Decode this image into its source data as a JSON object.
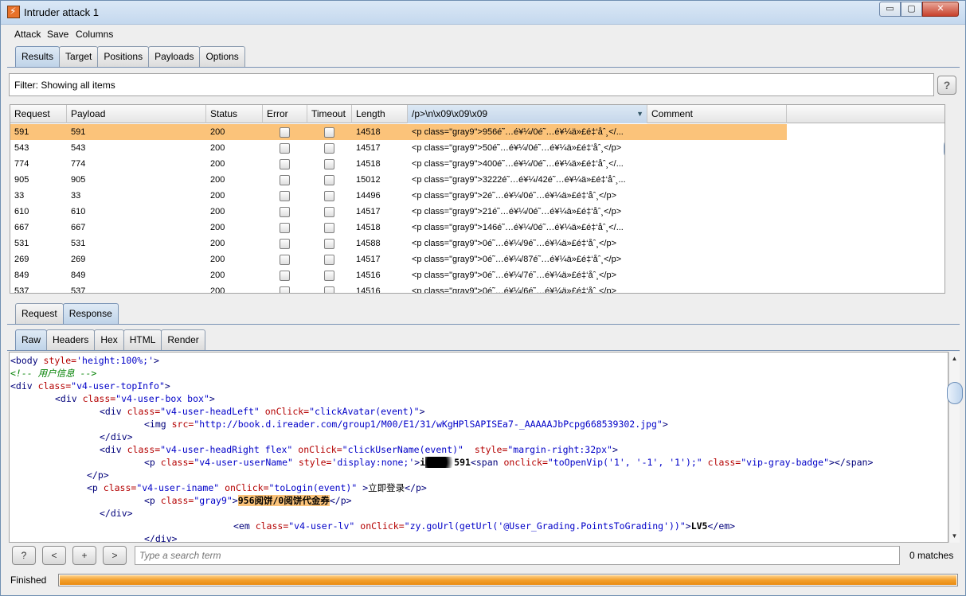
{
  "window": {
    "title": "Intruder attack 1"
  },
  "menu": [
    "Attack",
    "Save",
    "Columns"
  ],
  "main_tabs": [
    {
      "label": "Results",
      "active": true
    },
    {
      "label": "Target",
      "active": false
    },
    {
      "label": "Positions",
      "active": false
    },
    {
      "label": "Payloads",
      "active": false
    },
    {
      "label": "Options",
      "active": false
    }
  ],
  "filter": {
    "text": "Filter: Showing all items",
    "help": "?"
  },
  "results_table": {
    "columns": [
      "Request",
      "Payload",
      "Status",
      "Error",
      "Timeout",
      "Length",
      "/p>\\n\\x09\\x09\\x09",
      "Comment"
    ],
    "sorted_column": 6,
    "rows": [
      {
        "request": "591",
        "payload": "591",
        "status": "200",
        "length": "14518",
        "grep": "<p class=\"gray9\">956é˜…é¥¼/0é˜…é¥¼ä»£é‡‘åˆ¸</...",
        "selected": true
      },
      {
        "request": "543",
        "payload": "543",
        "status": "200",
        "length": "14517",
        "grep": "<p class=\"gray9\">50é˜…é¥¼/0é˜…é¥¼ä»£é‡‘åˆ¸</p>",
        "selected": false
      },
      {
        "request": "774",
        "payload": "774",
        "status": "200",
        "length": "14518",
        "grep": "<p class=\"gray9\">400é˜…é¥¼/0é˜…é¥¼ä»£é‡‘åˆ¸</...",
        "selected": false
      },
      {
        "request": "905",
        "payload": "905",
        "status": "200",
        "length": "15012",
        "grep": "<p class=\"gray9\">3222é˜…é¥¼/42é˜…é¥¼ä»£é‡‘åˆ¸...",
        "selected": false
      },
      {
        "request": "33",
        "payload": "33",
        "status": "200",
        "length": "14496",
        "grep": "<p class=\"gray9\">2é˜…é¥¼/0é˜…é¥¼ä»£é‡‘åˆ¸</p>",
        "selected": false
      },
      {
        "request": "610",
        "payload": "610",
        "status": "200",
        "length": "14517",
        "grep": "<p class=\"gray9\">21é˜…é¥¼/0é˜…é¥¼ä»£é‡‘åˆ¸</p>",
        "selected": false
      },
      {
        "request": "667",
        "payload": "667",
        "status": "200",
        "length": "14518",
        "grep": "<p class=\"gray9\">146é˜…é¥¼/0é˜…é¥¼ä»£é‡‘åˆ¸</...",
        "selected": false
      },
      {
        "request": "531",
        "payload": "531",
        "status": "200",
        "length": "14588",
        "grep": "<p class=\"gray9\">0é˜…é¥¼/9é˜…é¥¼ä»£é‡‘åˆ¸</p>",
        "selected": false
      },
      {
        "request": "269",
        "payload": "269",
        "status": "200",
        "length": "14517",
        "grep": "<p class=\"gray9\">0é˜…é¥¼/87é˜…é¥¼ä»£é‡‘åˆ¸</p>",
        "selected": false
      },
      {
        "request": "849",
        "payload": "849",
        "status": "200",
        "length": "14516",
        "grep": "<p class=\"gray9\">0é˜…é¥¼/7é˜…é¥¼ä»£é‡‘åˆ¸</p>",
        "selected": false
      },
      {
        "request": "537",
        "payload": "537",
        "status": "200",
        "length": "14516",
        "grep": "<p class=\"gray9\">0é˜…é¥¼/6é˜…é¥¼ä»£é‡‘åˆ¸</p>",
        "selected": false
      }
    ]
  },
  "req_resp_tabs": [
    {
      "label": "Request",
      "active": false
    },
    {
      "label": "Response",
      "active": true
    }
  ],
  "view_tabs": [
    {
      "label": "Raw",
      "active": true
    },
    {
      "label": "Headers",
      "active": false
    },
    {
      "label": "Hex",
      "active": false
    },
    {
      "label": "HTML",
      "active": false
    },
    {
      "label": "Render",
      "active": false
    }
  ],
  "response_code": {
    "l1_tag": "<body",
    "l1_attr": " style=",
    "l1_val": "'height:100%;'",
    "l1_end": ">",
    "l2": "<!-- 用户信息 -->",
    "l3_tag": "<div",
    "l3_attr": " class=",
    "l3_val": "\"v4-user-topInfo\"",
    "l3_end": ">",
    "l4_tag": "<div",
    "l4_attr": " class=",
    "l4_val": "\"v4-user-box box\"",
    "l4_end": ">",
    "l5_tag": "<div",
    "l5_attr1": " class=",
    "l5_val1": "\"v4-user-headLeft\"",
    "l5_attr2": " onClick=",
    "l5_val2": "\"clickAvatar(event)\"",
    "l5_end": ">",
    "l6_tag": "<img",
    "l6_attr": " src=",
    "l6_val": "\"http://book.d.ireader.com/group1/M00/E1/31/wKgHPlSAPISEa7-_AAAAAJbPcpg668539302.jpg\"",
    "l6_end": ">",
    "l7": "</div>",
    "l8_tag": "<div",
    "l8_attr1": " class=",
    "l8_val1": "\"v4-user-headRight flex\"",
    "l8_attr2": " onClick=",
    "l8_val2": "\"clickUserName(event)\"",
    "l8_attr3": "  style=",
    "l8_val3": "\"margin-right:32px\"",
    "l8_end": ">",
    "l9_tag": "<p",
    "l9_attr1": " class=",
    "l9_val1": "\"v4-user-userName\"",
    "l9_attr2": " style=",
    "l9_val2": "'display:none;'",
    "l9_end": ">",
    "l9_text_a": "i",
    "l9_text_b": "591",
    "l9_span": "<span",
    "l9_attr3": " onclick=",
    "l9_val3": "\"toOpenVip('1', '-1', '1');\"",
    "l9_attr4": " class=",
    "l9_val4": "\"vip-gray-badge\"",
    "l9_span_end": "></span>",
    "l10": "</p>",
    "l11_tag": "<p",
    "l11_attr1": " class=",
    "l11_val1": "\"v4-user-iname\"",
    "l11_attr2": " onClick=",
    "l11_val2": "\"toLogin(event)\"",
    "l11_end": " >",
    "l11_text": "立即登录",
    "l11_close": "</p>",
    "l12_tag": "<p",
    "l12_attr": " class=",
    "l12_val": "\"gray9\"",
    "l12_end": ">",
    "l12_text": "956阅饼/0阅饼代金券",
    "l12_close": "</p>",
    "l13": "</div>",
    "l14_tag": "<em",
    "l14_attr1": " class=",
    "l14_val1": "\"v4-user-lv\"",
    "l14_attr2": " onClick=",
    "l14_val2": "\"zy.goUrl(getUrl('@User_Grading.PointsToGrading'))\"",
    "l14_end": ">",
    "l14_text": "LV5",
    "l14_close": "</em>",
    "l15": "</div>"
  },
  "search": {
    "placeholder": "Type a search term",
    "matches": "0 matches",
    "help": "?",
    "prev": "<",
    "add": "+",
    "next": ">"
  },
  "status": {
    "text": "Finished",
    "progress": 1.0
  },
  "window_buttons": {
    "minimize": "▭",
    "maximize": "▢",
    "close": "✕"
  },
  "colors": {
    "highlight": "#fbc37a",
    "progress": "#f3a02d",
    "tag": "#00007a",
    "attr": "#b40000",
    "value": "#0000c8",
    "comment": "#008000"
  }
}
